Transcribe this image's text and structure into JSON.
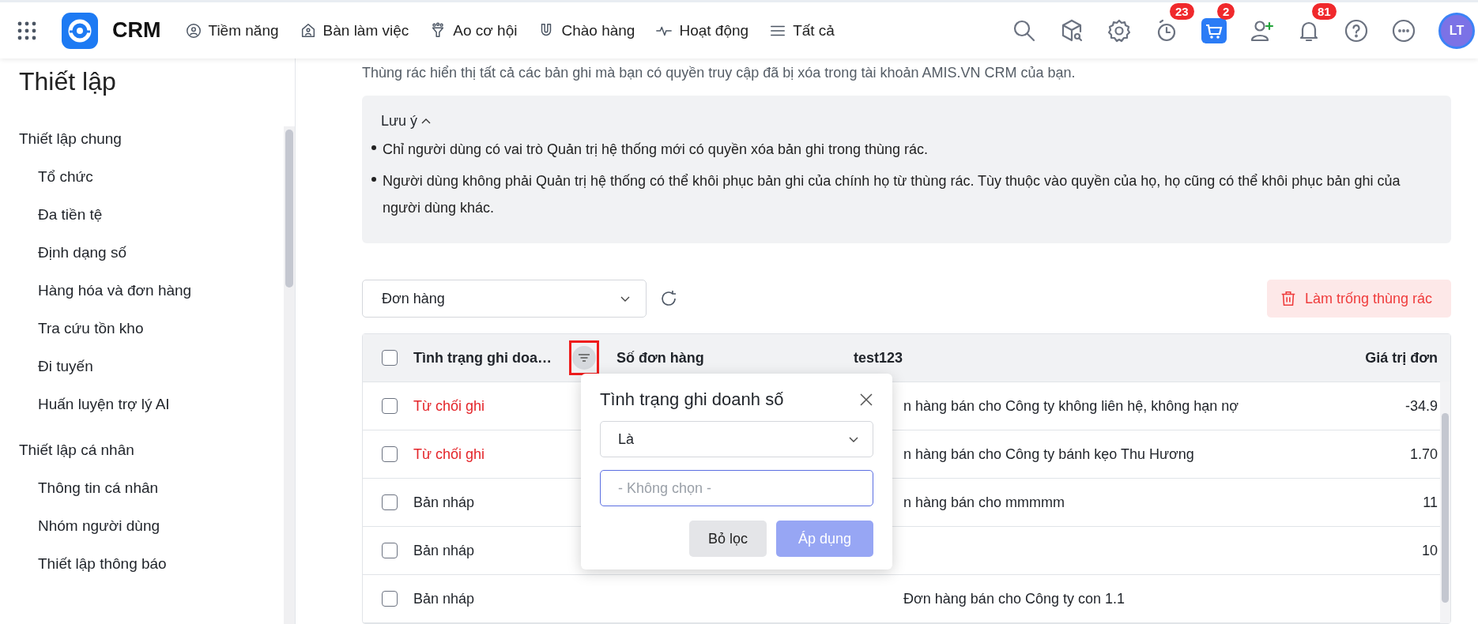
{
  "top_bar": {
    "brand": "CRM",
    "nav": [
      {
        "kind": "prospect",
        "label": "Tiềm năng"
      },
      {
        "kind": "desk",
        "label": "Bàn làm việc"
      },
      {
        "kind": "funnel",
        "label": "Ao cơ hội"
      },
      {
        "kind": "magnet",
        "label": "Chào hàng"
      },
      {
        "kind": "activity",
        "label": "Hoạt động"
      },
      {
        "kind": "menu",
        "label": "Tất cả"
      }
    ],
    "tools": [
      {
        "kind": "search"
      },
      {
        "kind": "box-search"
      },
      {
        "kind": "settings"
      },
      {
        "kind": "timer",
        "badge": "23"
      },
      {
        "kind": "cart",
        "badge": "2"
      },
      {
        "kind": "add-user"
      },
      {
        "kind": "bell",
        "badge": "81"
      },
      {
        "kind": "help"
      },
      {
        "kind": "more"
      }
    ],
    "avatar": "LT"
  },
  "sidebar": {
    "title": "Thiết lập",
    "groups": [
      {
        "title": "Thiết lập chung",
        "items": [
          "Tổ chức",
          "Đa tiền tệ",
          "Định dạng số",
          "Hàng hóa và đơn hàng",
          "Tra cứu tồn kho",
          "Đi tuyến",
          "Huấn luyện trợ lý AI"
        ]
      },
      {
        "title": "Thiết lập cá nhân",
        "items": [
          "Thông tin cá nhân",
          "Nhóm người dùng",
          "Thiết lập thông báo"
        ]
      }
    ]
  },
  "description": "Thùng rác hiển thị tất cả các bản ghi mà bạn có quyền truy cập đã bị xóa trong tài khoản AMIS.VN CRM của bạn.",
  "note": {
    "title": "Lưu ý",
    "expanded": true,
    "bullets": [
      "Chỉ người dùng có vai trò Quản trị hệ thống mới có quyền xóa bản ghi trong thùng rác.",
      "Người dùng không phải Quản trị hệ thống có thể khôi phục bản ghi của chính họ từ thùng rác. Tùy thuộc vào quyền của họ, họ cũng có thể khôi phục bản ghi của người dùng khác."
    ]
  },
  "record_type": "Đơn hàng",
  "empty_trash_button": "Làm trống thùng rác",
  "table": {
    "header_checked": false,
    "filter_highlighted": true,
    "columns": [
      "Tình trạng ghi doa…",
      "Số đơn hàng",
      "test123",
      "Giá trị đơn"
    ],
    "rows": [
      {
        "checked": false,
        "status": "Từ chối ghi",
        "kind": "rejected",
        "test123": "n hàng bán cho Công ty không liên hệ, không hạn nợ",
        "value": "-34.9"
      },
      {
        "checked": false,
        "status": "Từ chối ghi",
        "kind": "rejected",
        "test123": "n hàng bán cho Công ty bánh kẹo Thu Hương",
        "value": "1.70"
      },
      {
        "checked": false,
        "status": "Bản nháp",
        "kind": "draft",
        "test123": "n hàng bán cho mmmmm",
        "value": "11"
      },
      {
        "checked": false,
        "status": "Bản nháp",
        "kind": "draft",
        "value": "10"
      },
      {
        "checked": false,
        "status": "Bản nháp",
        "kind": "draft",
        "test123": "Đơn hàng bán cho Công ty con 1.1"
      }
    ]
  },
  "filter_popup": {
    "title": "Tình trạng ghi doanh số",
    "operator": "Là",
    "placeholder": "- Không chọn -",
    "clear_button": "Bỏ lọc",
    "apply_button": {
      "label": "Áp dụng",
      "disabled": true
    }
  }
}
